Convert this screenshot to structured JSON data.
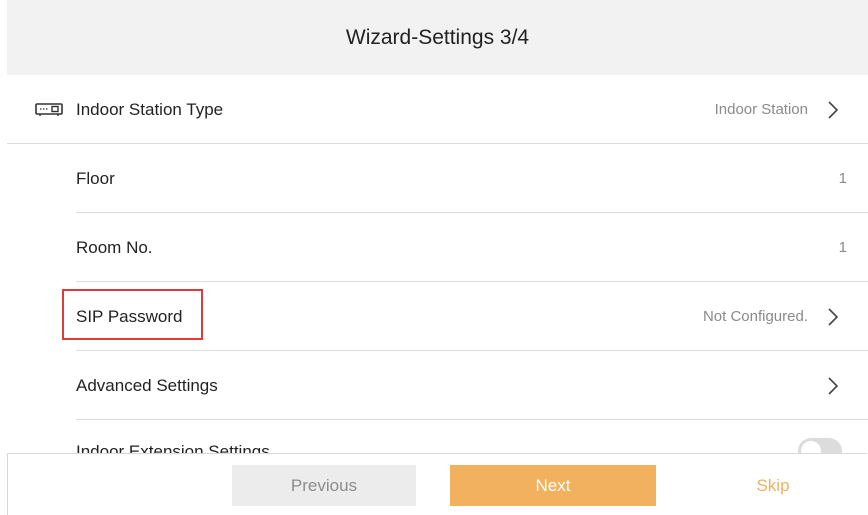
{
  "header": {
    "title": "Wizard-Settings 3/4"
  },
  "rows": [
    {
      "label": "Indoor Station Type",
      "value": "Indoor Station",
      "icon": "indoor-station-icon",
      "chevron": true
    },
    {
      "label": "Floor",
      "value": "1",
      "chevron": false
    },
    {
      "label": "Room No.",
      "value": "1",
      "chevron": false
    },
    {
      "label": "SIP Password",
      "value": "Not Configured.",
      "chevron": true
    },
    {
      "label": "Advanced Settings",
      "value": "",
      "chevron": true
    }
  ],
  "partial_row": {
    "label": "Indoor Extension Settings",
    "toggle_on": false
  },
  "footer": {
    "previous_label": "Previous",
    "next_label": "Next",
    "skip_label": "Skip"
  },
  "colors": {
    "accent": "#f1b15e",
    "highlight": "#e03a3a",
    "header_bg": "#f2f2f2"
  }
}
